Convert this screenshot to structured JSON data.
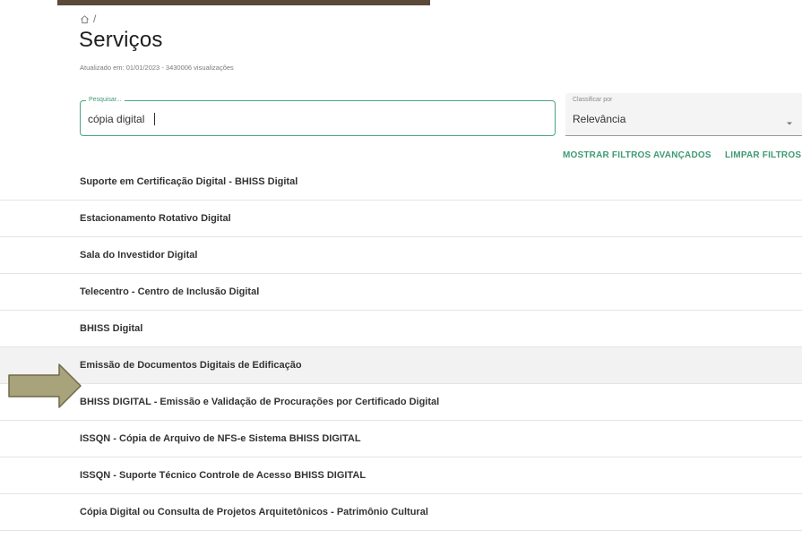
{
  "breadcrumb": {
    "separator": "/"
  },
  "page": {
    "title": "Serviços",
    "updated": "Atualizado em: 01/01/2023 - 3430006 visualizações"
  },
  "search": {
    "legend": "Pesquisar...",
    "value": "cópia digital"
  },
  "sort": {
    "label": "Classificar por",
    "value": "Relevância"
  },
  "filters": {
    "advanced": "MOSTRAR FILTROS AVANÇADOS",
    "clear": "LIMPAR FILTROS"
  },
  "results": [
    "Suporte em Certificação Digital - BHISS Digital",
    "Estacionamento Rotativo Digital",
    "Sala do Investidor Digital",
    "Telecentro - Centro de Inclusão Digital",
    "BHISS Digital",
    "Emissão de Documentos Digitais de Edificação",
    "BHISS DIGITAL - Emissão e Validação de Procurações por Certificado Digital",
    "ISSQN - Cópia de Arquivo de NFS-e Sistema BHISS DIGITAL",
    "ISSQN - Suporte Técnico Controle de Acesso BHISS DIGITAL",
    "Cópia Digital ou Consulta de Projetos Arquitetônicos - Patrimônio Cultural"
  ],
  "highlight_index": 5,
  "colors": {
    "accent": "#3f9a74",
    "arrow_fill": "#a8a37a",
    "arrow_stroke": "#6f6a48"
  }
}
